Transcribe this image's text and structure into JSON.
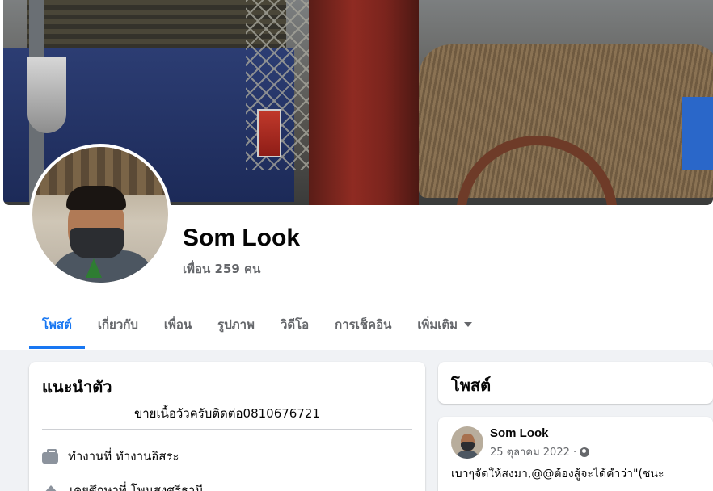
{
  "profile": {
    "name": "Som Look",
    "friends": "เพื่อน 259 คน"
  },
  "tabs": [
    {
      "label": "โพสต์"
    },
    {
      "label": "เกี่ยวกับ"
    },
    {
      "label": "เพื่อน"
    },
    {
      "label": "รูปภาพ"
    },
    {
      "label": "วิดีโอ"
    },
    {
      "label": "การเช็คอิน"
    },
    {
      "label": "เพิ่มเติม"
    }
  ],
  "intro": {
    "title": "แนะนำตัว",
    "bio": "ขายเนื้อวัวครับติดต่อ0810676721",
    "work": "ทำงานที่ ทำงานอิสระ",
    "education": "เคยศึกษาที่ โพนสูงศรีธานี"
  },
  "posts": {
    "title": "โพสต์",
    "items": [
      {
        "author": "Som Look",
        "date": "25 ตุลาคม 2022 ·",
        "text": "เบาๆจัดให้สงมา,@@ต้องสู้จะได้คำว่า\"(ชนะ"
      }
    ]
  },
  "colors": {
    "accent": "#1877f2",
    "secondary_text": "#65676b",
    "background": "#f0f2f5"
  },
  "icons": {
    "work": "briefcase-icon",
    "education": "graduation-cap-icon",
    "privacy": "globe-icon",
    "more": "caret-down-icon"
  }
}
